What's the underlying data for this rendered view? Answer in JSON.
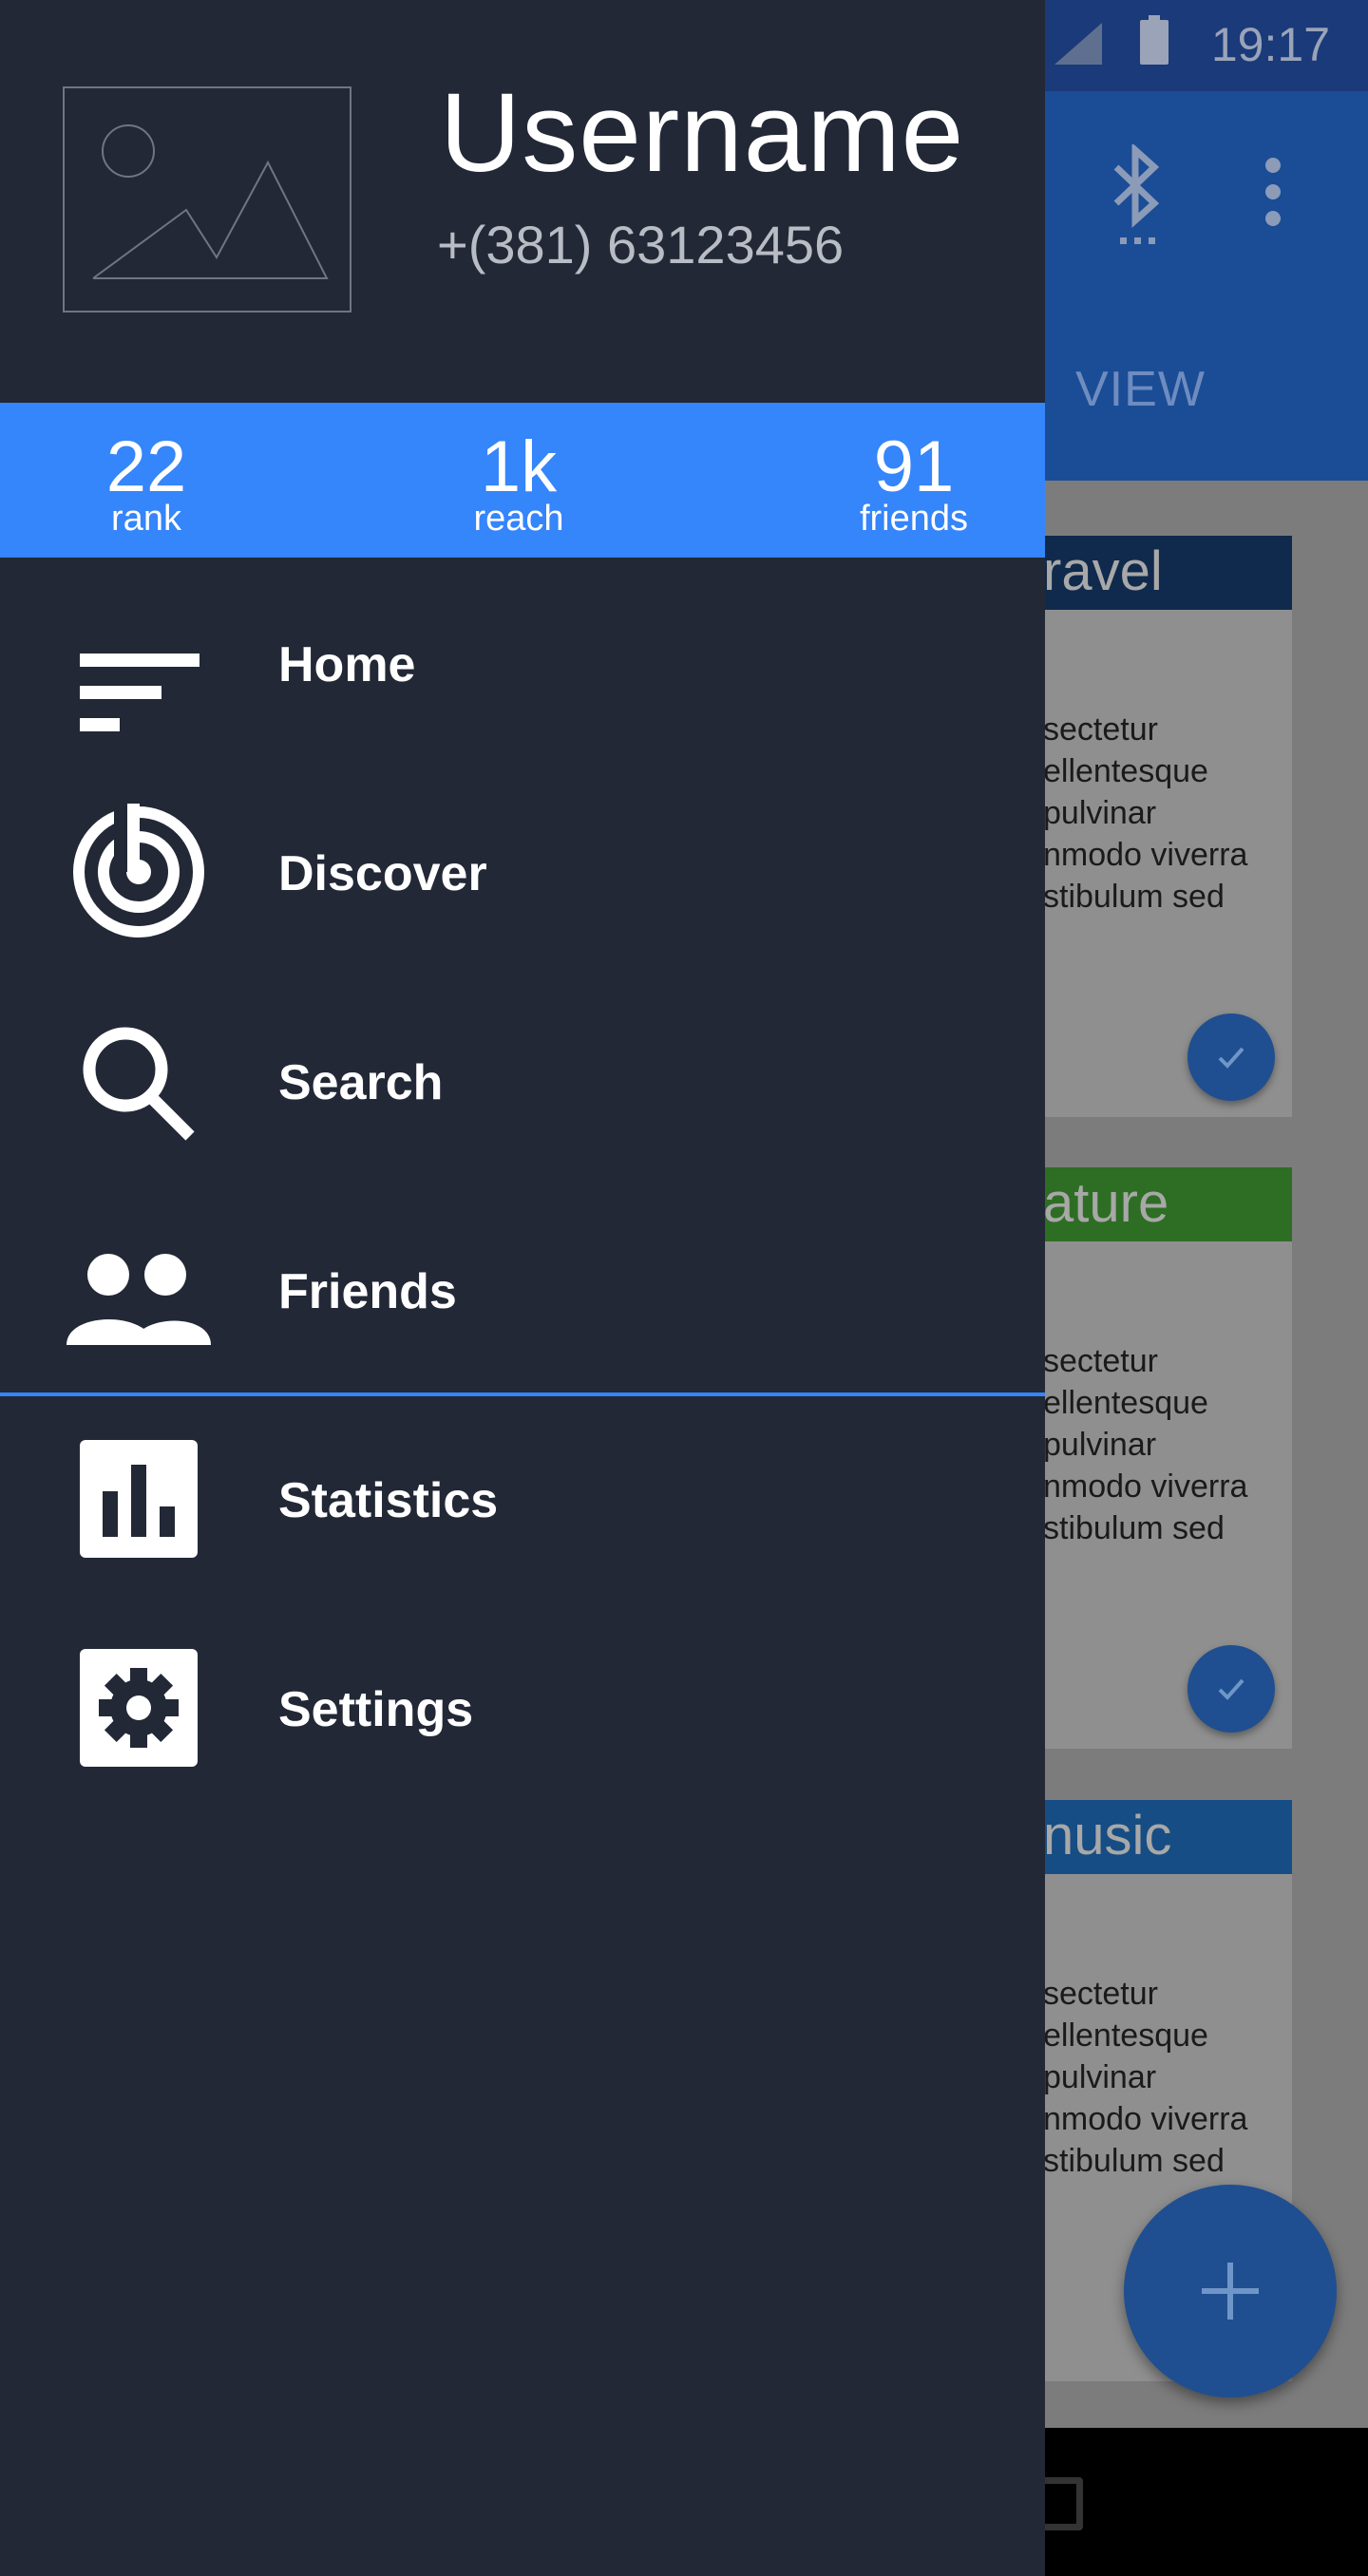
{
  "status_bar": {
    "time": "19:17"
  },
  "app_bar": {
    "tab_label": "VIEW"
  },
  "cards": [
    {
      "category": "ravel",
      "header_color": "#0f2a4c",
      "body": "sectetur\nellentesque\npulvinar\nnmodo viverra\nstibulum sed"
    },
    {
      "category": "ature",
      "header_color": "#2e6e24",
      "body": "sectetur\nellentesque\npulvinar\nnmodo viverra\nstibulum sed"
    },
    {
      "category": "nusic",
      "header_color": "#164d84",
      "body": "sectetur\nellentesque\npulvinar\nnmodo viverra\nstibulum sed"
    }
  ],
  "drawer": {
    "profile": {
      "username": "Username",
      "phone": "+(381) 63123456"
    },
    "stats": [
      {
        "value": "22",
        "label": "rank"
      },
      {
        "value": "1k",
        "label": "reach"
      },
      {
        "value": "91",
        "label": "friends"
      }
    ],
    "menu": [
      {
        "label": "Home",
        "icon": "sort-lines-icon"
      },
      {
        "label": "Discover",
        "icon": "radar-icon"
      },
      {
        "label": "Search",
        "icon": "search-icon"
      },
      {
        "label": "Friends",
        "icon": "people-icon"
      },
      {
        "label": "Statistics",
        "icon": "bar-chart-icon"
      },
      {
        "label": "Settings",
        "icon": "gear-icon"
      }
    ]
  },
  "colors": {
    "drawer_bg": "#222836",
    "accent": "#3585fb",
    "text_primary": "#ffffff",
    "text_secondary": "#b9bcc4"
  }
}
